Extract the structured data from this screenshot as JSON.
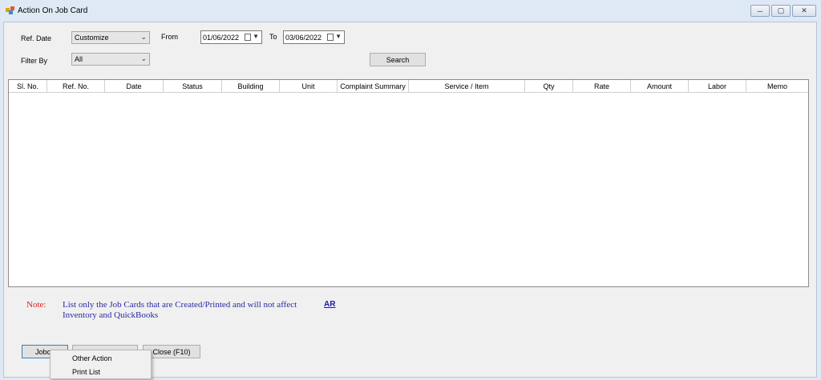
{
  "window": {
    "title": "Action On Job Card",
    "min_icon": "minimize-icon",
    "max_icon": "maximize-icon",
    "close_icon": "close-icon"
  },
  "filters": {
    "ref_date_label": "Ref. Date",
    "ref_date_value": "Customize",
    "from_label": "From",
    "from_value": "01/06/2022",
    "to_label": "To",
    "to_value": "03/06/2022",
    "filter_by_label": "Filter By",
    "filter_by_value": "All",
    "search_label": "Search"
  },
  "table": {
    "columns": [
      "Sl. No.",
      "Ref. No.",
      "Date",
      "Status",
      "Building",
      "Unit",
      "Complaint Summary",
      "Service / Item",
      "Qty",
      "Rate",
      "Amount",
      "Labor",
      "Memo"
    ],
    "rows": []
  },
  "note": {
    "label": "Note:",
    "text": "List only the Job Cards that are Created/Printed and will not affect Inventory and QuickBooks",
    "link": "AR"
  },
  "buttons": {
    "jobcard": "Jobca",
    "close": "Close (F10)"
  },
  "context_menu": {
    "items": [
      "Other Action",
      "Print List"
    ]
  },
  "colors": {
    "note_label": "#e02020",
    "note_text": "#2a2aa6",
    "background": "#dfe9f5"
  }
}
